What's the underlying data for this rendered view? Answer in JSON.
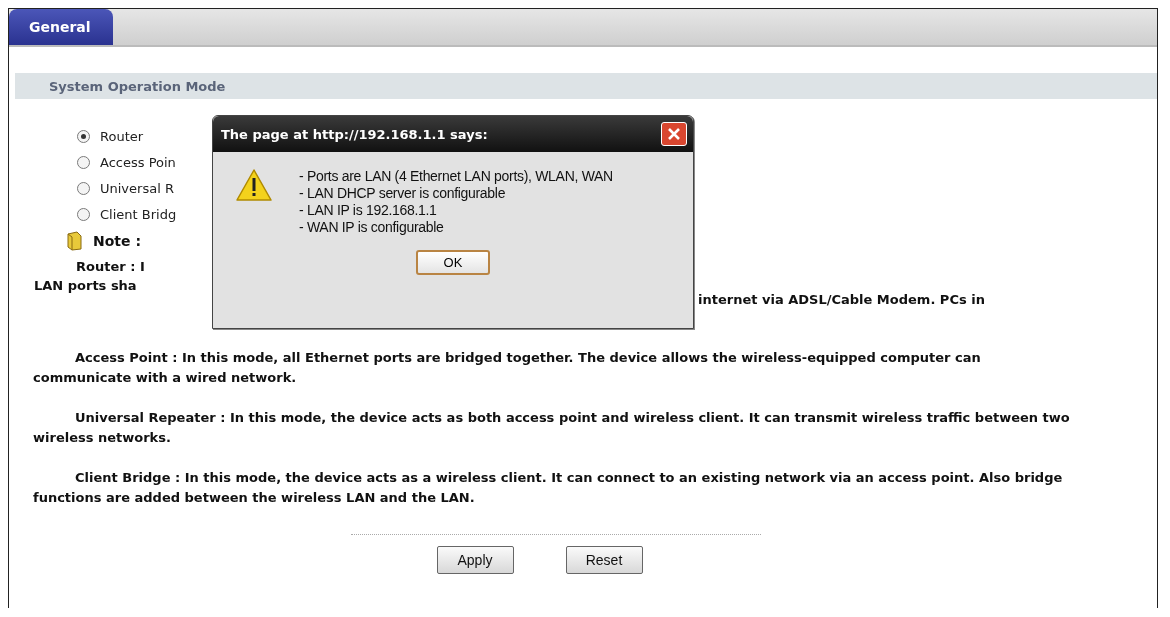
{
  "tabs": [
    {
      "label": "General",
      "selected": true
    }
  ],
  "section_title": "System Operation Mode",
  "modes": [
    {
      "label": "Router",
      "selected": true
    },
    {
      "label": "Access Poin",
      "selected": false
    },
    {
      "label": "Universal R",
      "selected": false
    },
    {
      "label": "Client Bridg",
      "selected": false
    }
  ],
  "note_label": "Note :",
  "router_note": {
    "start": "Router : I",
    "end": "internet via ADSL/Cable Modem. PCs in",
    "second_line": "LAN ports sha"
  },
  "notes": [
    "Access Point : In this mode, all Ethernet ports are bridged together. The device allows the wireless-equipped computer can communicate with a wired network.",
    "Universal Repeater : In this mode, the device acts as both access point and wireless client. It can transmit wireless traffic between two wireless networks.",
    "Client Bridge : In this mode, the device acts as a wireless client. It can connect to an existing network via an access point. Also bridge functions are added between the wireless LAN and the LAN."
  ],
  "dialog": {
    "title": "The page at http://192.168.1.1 says:",
    "lines": [
      "- Ports are LAN (4 Ethernet LAN ports), WLAN, WAN",
      "- LAN DHCP server is configurable",
      "- LAN IP is 192.168.1.1",
      "- WAN IP is configurable"
    ],
    "ok": "OK"
  },
  "buttons": [
    "Apply",
    "Reset"
  ]
}
